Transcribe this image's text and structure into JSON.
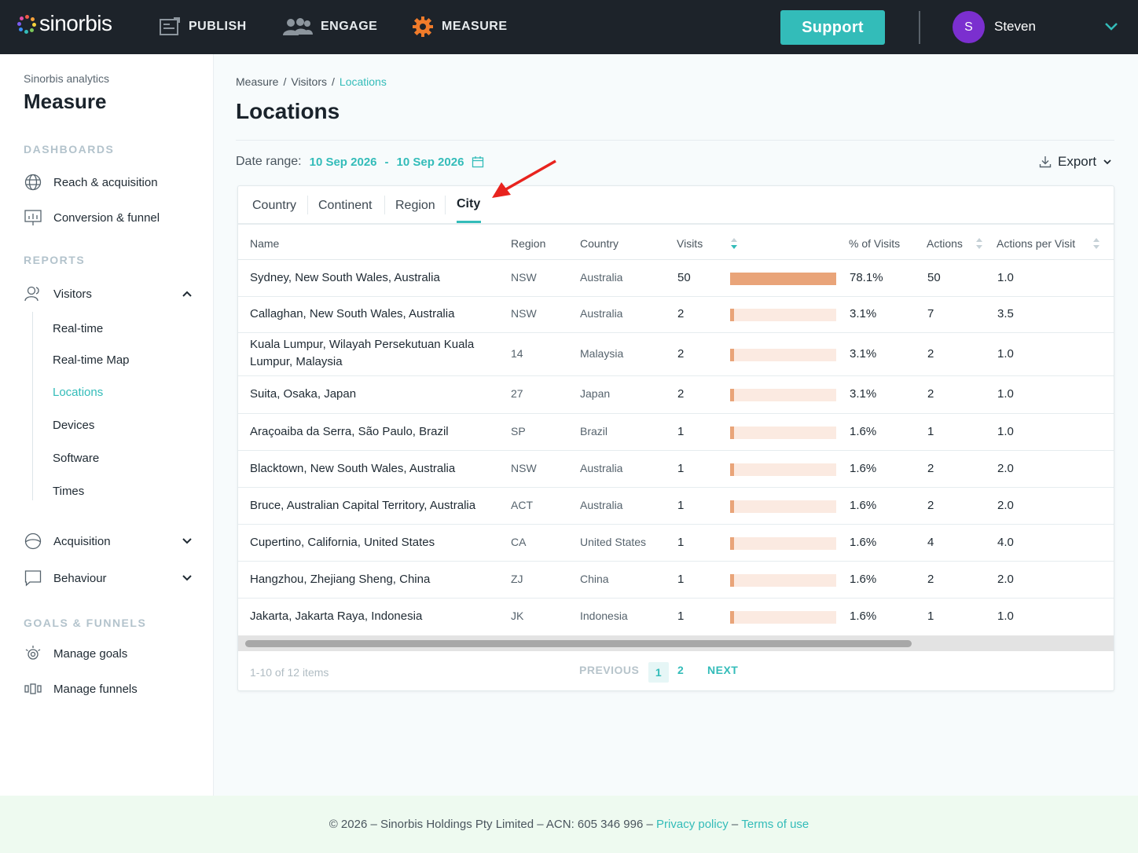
{
  "brand": {
    "name": "sinorbis",
    "accent": "#33bcb9",
    "dark": "#1d232a",
    "bar": "#e9a479",
    "bar_track": "#fbeae1"
  },
  "topnav": {
    "items": [
      {
        "label": "PUBLISH",
        "icon": "publish-icon"
      },
      {
        "label": "ENGAGE",
        "icon": "users-icon"
      },
      {
        "label": "MEASURE",
        "icon": "gear-icon"
      }
    ],
    "support_label": "Support",
    "user": {
      "initial": "S",
      "name": "Steven"
    }
  },
  "sidebar": {
    "app_name": "Sinorbis analytics",
    "title": "Measure",
    "sections": {
      "dashboards": "DASHBOARDS",
      "reports": "REPORTS",
      "goals": "GOALS & FUNNELS"
    },
    "dashboards": [
      {
        "label": "Reach & acquisition",
        "icon": "globe-icon"
      },
      {
        "label": "Conversion & funnel",
        "icon": "chart-icon"
      }
    ],
    "reports": {
      "visitors": "Visitors",
      "visitor_subitems": [
        "Real-time",
        "Real-time Map",
        "Locations",
        "Devices",
        "Software",
        "Times"
      ],
      "acquisition": "Acquisition",
      "behaviour": "Behaviour"
    },
    "goals": [
      {
        "label": "Manage goals",
        "icon": "target-icon"
      },
      {
        "label": "Manage funnels",
        "icon": "funnel-icon"
      }
    ]
  },
  "main": {
    "breadcrumb": [
      "Measure",
      "/",
      "Visitors",
      "/",
      "Locations"
    ],
    "title": "Locations",
    "date_range_label": "Date range:",
    "date_from": "10 Sep 2026",
    "date_sep": "-",
    "date_to": "10 Sep 2026",
    "export_label": "Export",
    "tabs": [
      "Country",
      "Continent",
      "Region",
      "City"
    ],
    "active_tab": "City",
    "columns": [
      "Name",
      "Region",
      "Country",
      "Visits",
      "% of Visits",
      "Actions",
      "Actions per Visit"
    ],
    "rows": [
      {
        "name": "Sydney, New South Wales, Australia",
        "region": "NSW",
        "country": "Australia",
        "visits": "50",
        "share": 0.781,
        "pct": "78.1%",
        "actions": "50",
        "apv": "1.0"
      },
      {
        "name": "Callaghan, New South Wales, Australia",
        "region": "NSW",
        "country": "Australia",
        "visits": "2",
        "share": 0.031,
        "pct": "3.1%",
        "actions": "7",
        "apv": "3.5"
      },
      {
        "name": "Kuala Lumpur, Wilayah Persekutuan Kuala Lumpur, Malaysia",
        "region": "14",
        "country": "Malaysia",
        "visits": "2",
        "share": 0.031,
        "pct": "3.1%",
        "actions": "2",
        "apv": "1.0"
      },
      {
        "name": "Suita, Osaka, Japan",
        "region": "27",
        "country": "Japan",
        "visits": "2",
        "share": 0.031,
        "pct": "3.1%",
        "actions": "2",
        "apv": "1.0"
      },
      {
        "name": "Araçoaiba da Serra, São Paulo, Brazil",
        "region": "SP",
        "country": "Brazil",
        "visits": "1",
        "share": 0.016,
        "pct": "1.6%",
        "actions": "1",
        "apv": "1.0"
      },
      {
        "name": "Blacktown, New South Wales, Australia",
        "region": "NSW",
        "country": "Australia",
        "visits": "1",
        "share": 0.016,
        "pct": "1.6%",
        "actions": "2",
        "apv": "2.0"
      },
      {
        "name": "Bruce, Australian Capital Territory, Australia",
        "region": "ACT",
        "country": "Australia",
        "visits": "1",
        "share": 0.016,
        "pct": "1.6%",
        "actions": "2",
        "apv": "2.0"
      },
      {
        "name": "Cupertino, California, United States",
        "region": "CA",
        "country": "United States",
        "visits": "1",
        "share": 0.016,
        "pct": "1.6%",
        "actions": "4",
        "apv": "4.0"
      },
      {
        "name": "Hangzhou, Zhejiang Sheng, China",
        "region": "ZJ",
        "country": "China",
        "visits": "1",
        "share": 0.016,
        "pct": "1.6%",
        "actions": "2",
        "apv": "2.0"
      },
      {
        "name": "Jakarta, Jakarta Raya, Indonesia",
        "region": "JK",
        "country": "Indonesia",
        "visits": "1",
        "share": 0.016,
        "pct": "1.6%",
        "actions": "1",
        "apv": "1.0"
      }
    ],
    "pagination": {
      "info": "1-10 of 12 items",
      "previous": "PREVIOUS",
      "pages": [
        "1",
        "2"
      ],
      "current": "1",
      "next": "NEXT"
    }
  },
  "footer": {
    "text": "© 2026 – Sinorbis Holdings Pty Limited – ACN: 605 346 996 –",
    "privacy": "Privacy policy",
    "sep": "–",
    "terms": "Terms of use"
  }
}
